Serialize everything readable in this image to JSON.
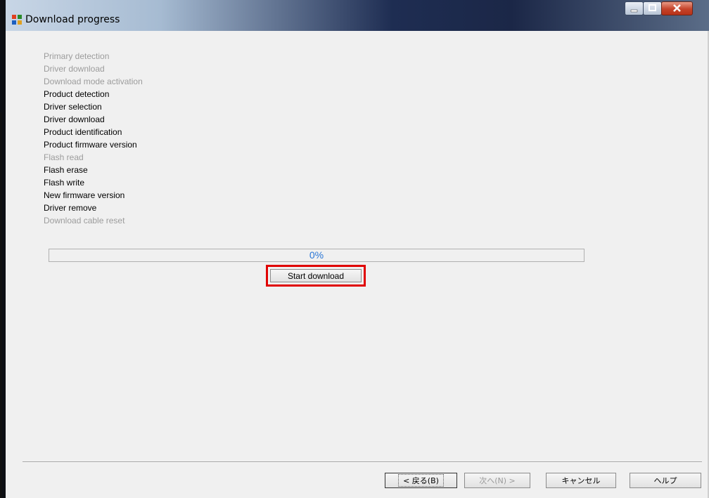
{
  "window": {
    "title": "Download progress"
  },
  "steps": [
    {
      "label": "Primary detection",
      "state": "done"
    },
    {
      "label": "Driver download",
      "state": "done"
    },
    {
      "label": " Download mode activation",
      "state": "done"
    },
    {
      "label": "Product detection",
      "state": "active"
    },
    {
      "label": "Driver selection",
      "state": "active"
    },
    {
      "label": "Driver download",
      "state": "active"
    },
    {
      "label": "Product identification",
      "state": "active"
    },
    {
      "label": "Product firmware version",
      "state": "active"
    },
    {
      "label": "Flash read",
      "state": "done"
    },
    {
      "label": "Flash erase",
      "state": "active"
    },
    {
      "label": "Flash write",
      "state": "active"
    },
    {
      "label": "New firmware version",
      "state": "active"
    },
    {
      "label": "Driver remove",
      "state": "active"
    },
    {
      "label": "Download cable reset",
      "state": "done"
    }
  ],
  "progress": {
    "text": "0%",
    "value": 0
  },
  "actions": {
    "start_label": "Start download"
  },
  "footer": {
    "back_label": "< 戻る(B)",
    "next_label": "次へ(N) >",
    "cancel_label": "キャンセル",
    "help_label": "ヘルプ"
  },
  "colors": {
    "highlight_border": "#e00000",
    "progress_text": "#2a76d6",
    "disabled_text": "#9c9c9c"
  }
}
